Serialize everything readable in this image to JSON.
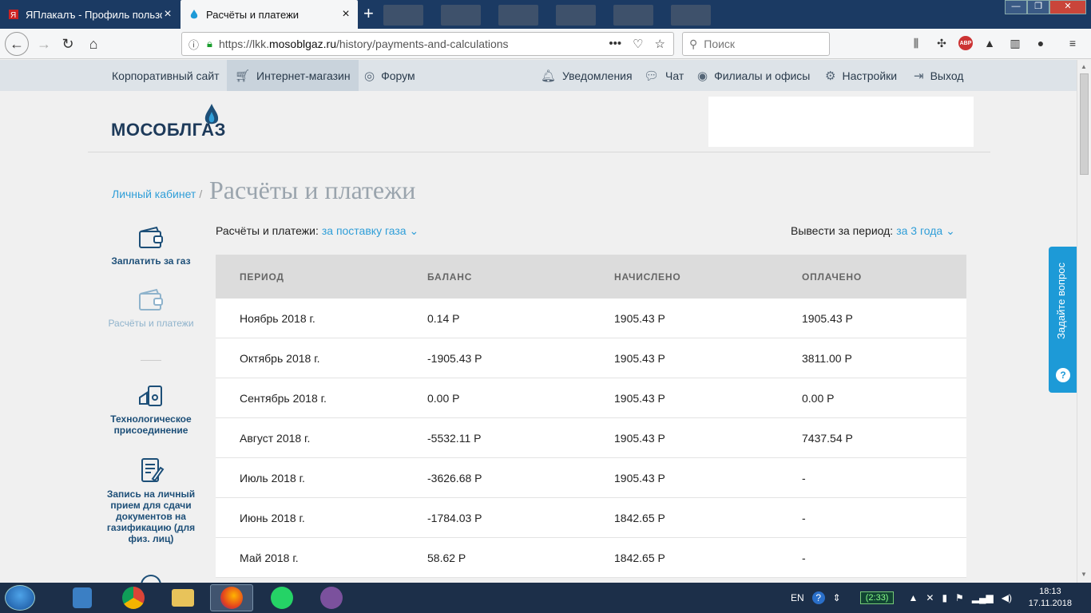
{
  "browser": {
    "tabs": [
      {
        "title": "ЯПлакалъ - Профиль пользов",
        "active": false
      },
      {
        "title": "Расчёты и платежи",
        "active": true
      }
    ],
    "url_prefix": "https://lkk.",
    "url_domain": "mosoblgaz.ru",
    "url_path": "/history/payments-and-calculations",
    "search_placeholder": "Поиск",
    "window_controls": {
      "minimize": "—",
      "maximize": "❐",
      "close": "✕"
    }
  },
  "site_menu": {
    "left": [
      {
        "label": "Корпоративный сайт",
        "icon": null
      },
      {
        "label": "Интернет-магазин",
        "icon": "cart-icon"
      },
      {
        "label": "Форум",
        "icon": "globe-icon"
      }
    ],
    "right": [
      {
        "label": "Уведомления",
        "icon": "bell-icon"
      },
      {
        "label": "Чат",
        "icon": "chat-icon"
      },
      {
        "label": "Филиалы и офисы",
        "icon": "office-icon"
      },
      {
        "label": "Настройки",
        "icon": "gear-icon"
      },
      {
        "label": "Выход",
        "icon": "logout-icon"
      }
    ]
  },
  "logo": {
    "text": "МОСОБЛГАЗ"
  },
  "breadcrumb": {
    "link": "Личный кабинет",
    "separator": "/"
  },
  "page_title": "Расчёты и платежи",
  "filters": {
    "type_label": "Расчёты и платежи:",
    "type_value": "за поставку газа",
    "period_label": "Вывести за период:",
    "period_value": "за 3 года"
  },
  "sidebar": [
    {
      "label": "Заплатить за газ",
      "icon": "wallet-icon",
      "active": false
    },
    {
      "label": "Расчёты и платежи",
      "icon": "wallet-icon",
      "active": true
    },
    {
      "label": "Технологическое присоединение",
      "icon": "connection-icon",
      "active": false
    },
    {
      "label": "Запись на личный прием для сдачи документов на газификацию (для физ. лиц)",
      "icon": "document-icon",
      "active": false
    }
  ],
  "table": {
    "columns": [
      "ПЕРИОД",
      "БАЛАНС",
      "НАЧИСЛЕНО",
      "ОПЛАЧЕНО"
    ],
    "rows": [
      [
        "Ноябрь 2018 г.",
        "0.14 Р",
        "1905.43 Р",
        "1905.43 Р"
      ],
      [
        "Октябрь 2018 г.",
        "-1905.43 Р",
        "1905.43 Р",
        "3811.00 Р"
      ],
      [
        "Сентябрь 2018 г.",
        "0.00 Р",
        "1905.43 Р",
        "0.00 Р"
      ],
      [
        "Август 2018 г.",
        "-5532.11 Р",
        "1905.43 Р",
        "7437.54 Р"
      ],
      [
        "Июль 2018 г.",
        "-3626.68 Р",
        "1905.43 Р",
        "-"
      ],
      [
        "Июнь 2018 г.",
        "-1784.03 Р",
        "1842.65 Р",
        "-"
      ],
      [
        "Май 2018 г.",
        "58.62 Р",
        "1842.65 Р",
        "-"
      ]
    ]
  },
  "ask_button": {
    "label": "Задайте вопрос"
  },
  "taskbar": {
    "lang": "EN",
    "battery": "(2:33)",
    "time": "18:13",
    "date": "17.11.2018"
  },
  "colors": {
    "accent": "#2f9ed8",
    "brand_dark": "#1d3a5a",
    "ask": "#1d9ad7"
  }
}
